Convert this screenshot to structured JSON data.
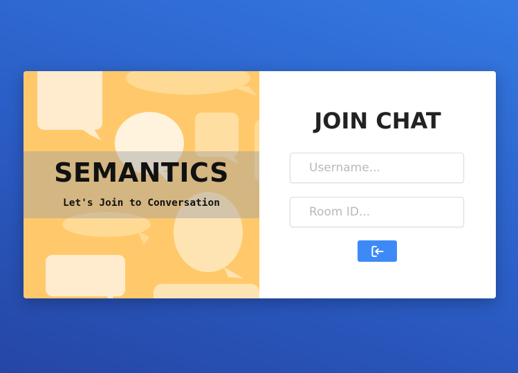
{
  "brand": {
    "title": "SEMANTICS",
    "tagline": "Let's Join to Conversation"
  },
  "join_form": {
    "title": "JOIN CHAT",
    "username_placeholder": "Username...",
    "room_placeholder": "Room ID...",
    "submit_icon": "login-icon"
  },
  "colors": {
    "background_top": "#3479e2",
    "background_bottom": "#2546a6",
    "panel_yellow": "#ffc96b",
    "bubble_cream": "#ffefd6",
    "button_blue": "#3d8af7",
    "title_text": "#222222"
  }
}
